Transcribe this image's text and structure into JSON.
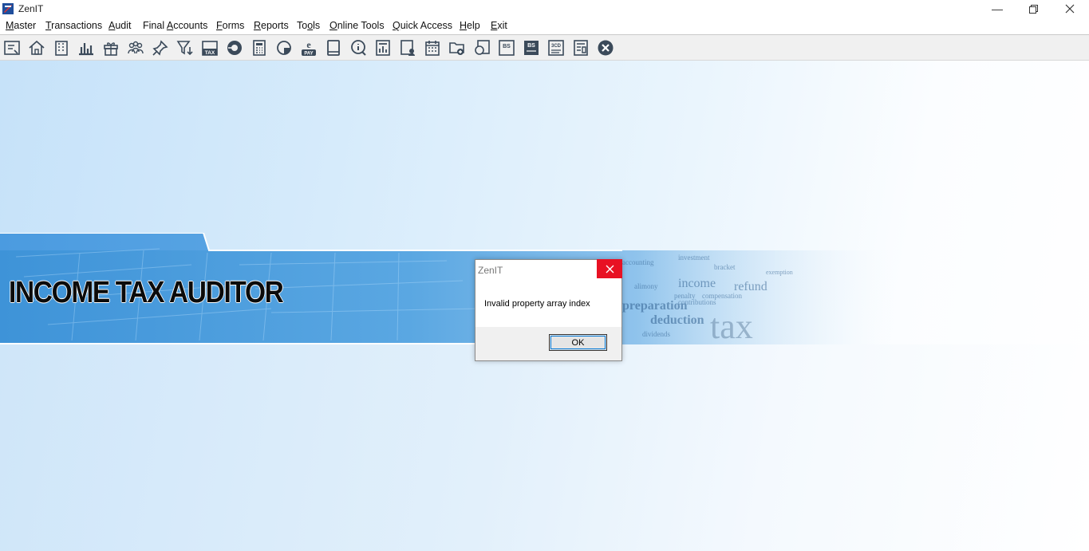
{
  "window": {
    "title": "ZenIT",
    "minimize_icon": "minimize-icon",
    "restore_icon": "restore-icon",
    "close_icon": "close-icon"
  },
  "menu": [
    {
      "label": "Master",
      "underline": "M",
      "rest": "aster"
    },
    {
      "label": "Transactions",
      "underline": "T",
      "rest": "ransactions"
    },
    {
      "label": "Audit",
      "underline": "A",
      "rest": "udit"
    },
    {
      "label": "Final Accounts",
      "pre": "Final ",
      "underline": "A",
      "rest": "ccounts"
    },
    {
      "label": "Forms",
      "underline": "F",
      "rest": "orms"
    },
    {
      "label": "Reports",
      "underline": "R",
      "rest": "eports"
    },
    {
      "label": "Tools",
      "pre": "To",
      "underline": "o",
      "rest": "ls"
    },
    {
      "label": "Online Tools",
      "underline": "O",
      "rest": "nline Tools"
    },
    {
      "label": "Quick Access",
      "underline": "Q",
      "rest": "uick Access"
    },
    {
      "label": "Help",
      "underline": "H",
      "rest": "elp"
    },
    {
      "label": "Exit",
      "underline": "E",
      "rest": "xit"
    }
  ],
  "toolbar": {
    "icons": [
      "ledger-icon",
      "home-icon",
      "building-icon",
      "bar-chart-icon",
      "gift-icon",
      "users-icon",
      "pin-icon",
      "filter-icon",
      "tax-icon",
      "disc-icon",
      "calculator-icon",
      "pie-chart-icon",
      "e-pay-icon",
      "book-icon",
      "info-icon",
      "report-icon",
      "user-doc-icon",
      "calendar-icon",
      "folder-add-icon",
      "refresh-doc-icon",
      "bs-icon",
      "bs-gh-icon",
      "3cd-icon",
      "form-icon",
      "close-circle-icon"
    ],
    "tax_label": "TAX",
    "epay_label": "PAY",
    "bs_label": "BS",
    "bsgh_label": "BS",
    "cd_label": "3CD"
  },
  "banner": {
    "title": "INCOME TAX AUDITOR"
  },
  "dialog": {
    "title": "ZenIT",
    "message": "Invalid property array index",
    "ok_label": "OK",
    "close_icon": "close-icon"
  },
  "colors": {
    "accent": "#0078d7",
    "close_red": "#e81123",
    "banner_blue": "#3a8fd4"
  }
}
